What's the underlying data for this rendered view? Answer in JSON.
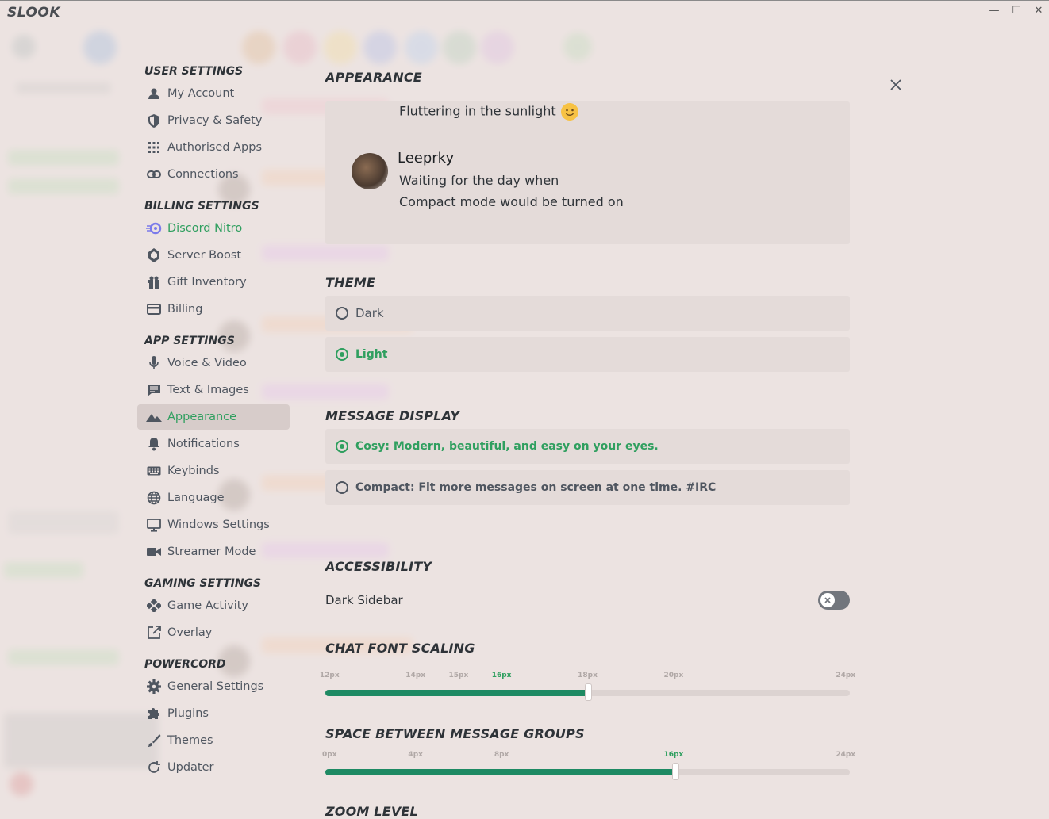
{
  "window": {
    "title": "SLOOK",
    "minimize": "—",
    "maximize": "☐",
    "close": "✕"
  },
  "sidebar": {
    "user_settings": {
      "title": "USER SETTINGS",
      "items": [
        "My Account",
        "Privacy & Safety",
        "Authorised Apps",
        "Connections"
      ]
    },
    "billing_settings": {
      "title": "BILLING SETTINGS",
      "items": [
        "Discord Nitro",
        "Server Boost",
        "Gift Inventory",
        "Billing"
      ]
    },
    "app_settings": {
      "title": "APP SETTINGS",
      "items": [
        "Voice & Video",
        "Text & Images",
        "Appearance",
        "Notifications",
        "Keybinds",
        "Language",
        "Windows Settings",
        "Streamer Mode"
      ]
    },
    "gaming_settings": {
      "title": "GAMING SETTINGS",
      "items": [
        "Game Activity",
        "Overlay"
      ]
    },
    "powercord": {
      "title": "POWERCORD",
      "items": [
        "General Settings",
        "Plugins",
        "Themes",
        "Updater"
      ]
    },
    "selected": "Appearance"
  },
  "appearance": {
    "title": "APPEARANCE",
    "preview": {
      "line1": "Fluttering in the sunlight",
      "username": "Leeprky",
      "line2": "Waiting for the day when",
      "line3": "Compact mode would be turned on"
    }
  },
  "theme": {
    "title": "THEME",
    "options": [
      "Dark",
      "Light"
    ],
    "selected": "Light"
  },
  "message_display": {
    "title": "MESSAGE DISPLAY",
    "options": [
      "Cosy: Modern, beautiful, and easy on your eyes.",
      "Compact: Fit more messages on screen at one time. #IRC"
    ],
    "selected": "Cosy: Modern, beautiful, and easy on your eyes."
  },
  "accessibility": {
    "title": "ACCESSIBILITY",
    "dark_sidebar_label": "Dark Sidebar",
    "dark_sidebar_enabled": false
  },
  "chat_font_scaling": {
    "title": "CHAT FONT SCALING",
    "ticks": [
      "12px",
      "14px",
      "15px",
      "16px",
      "18px",
      "20px",
      "24px"
    ],
    "selected": "16px",
    "value_fraction": 0.5
  },
  "space_between_groups": {
    "title": "SPACE BETWEEN MESSAGE GROUPS",
    "ticks": [
      "0px",
      "4px",
      "8px",
      "16px",
      "24px"
    ],
    "selected": "16px",
    "value_fraction": 0.667
  },
  "zoom_level": {
    "title": "ZOOM LEVEL"
  },
  "colors": {
    "accent": "#2f9f5f",
    "slider_fill": "#1e8a63",
    "background": "#ece3e1"
  }
}
